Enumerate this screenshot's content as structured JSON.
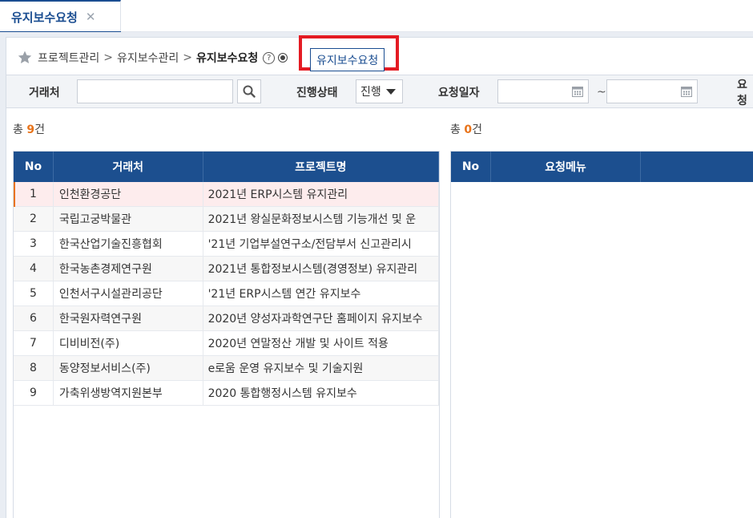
{
  "tab": {
    "label": "유지보수요청",
    "close": "✕"
  },
  "breadcrumb": {
    "items": [
      "프로젝트관리",
      "유지보수관리"
    ],
    "separator": ">",
    "current": "유지보수요청",
    "help": "?"
  },
  "action_button": "유지보수요청",
  "search": {
    "customer_label": "거래처",
    "customer_value": "",
    "status_label": "진행상태",
    "status_value": "진행",
    "date_label": "요청일자",
    "date_from": "",
    "date_to": "",
    "tilde": "~",
    "next_label": "요청"
  },
  "left": {
    "count_prefix": "총 ",
    "count": "9",
    "count_suffix": "건",
    "columns": [
      "No",
      "거래처",
      "프로젝트명"
    ],
    "rows": [
      {
        "no": "1",
        "customer": "인천환경공단",
        "project": "2021년 ERP시스템 유지관리"
      },
      {
        "no": "2",
        "customer": "국립고궁박물관",
        "project": "2021년 왕실문화정보시스템 기능개선 및 운"
      },
      {
        "no": "3",
        "customer": "한국산업기술진흥협회",
        "project": "'21년 기업부설연구소/전담부서 신고관리시"
      },
      {
        "no": "4",
        "customer": "한국농촌경제연구원",
        "project": "2021년 통합정보시스템(경영정보) 유지관리"
      },
      {
        "no": "5",
        "customer": "인천서구시설관리공단",
        "project": "'21년 ERP시스템 연간 유지보수"
      },
      {
        "no": "6",
        "customer": "한국원자력연구원",
        "project": "2020년 양성자과학연구단 홈페이지 유지보수"
      },
      {
        "no": "7",
        "customer": "디비비전(주)",
        "project": "2020년 연말정산 개발 및 사이트 적용"
      },
      {
        "no": "8",
        "customer": "동양정보서비스(주)",
        "project": "e로움 운영 유지보수 및 기술지원"
      },
      {
        "no": "9",
        "customer": "가축위생방역지원본부",
        "project": "2020 통합행정시스템 유지보수"
      }
    ]
  },
  "right": {
    "count_prefix": "총 ",
    "count": "0",
    "count_suffix": "건",
    "columns": [
      "No",
      "요청메뉴"
    ]
  },
  "colors": {
    "accent": "#1c4f8f",
    "highlight": "#e41b23",
    "count": "#e8731a"
  }
}
